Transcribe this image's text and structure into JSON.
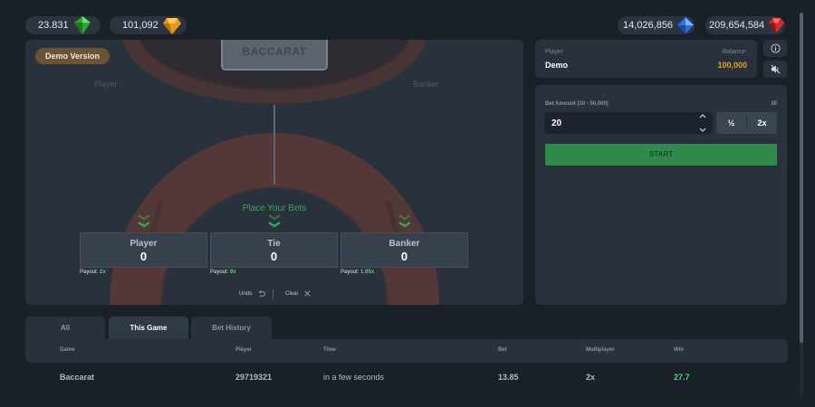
{
  "balances": {
    "green": "23.831",
    "orange": "101,092",
    "blue": "14,026,856",
    "red": "209,654,584"
  },
  "icons": {
    "green": "green-gem-icon",
    "orange": "orange-gem-icon",
    "blue": "blue-gem-icon",
    "red": "red-gem-icon",
    "info": "info-icon",
    "sound": "sound-off-icon",
    "undo": "undo-icon",
    "clear": "close-icon"
  },
  "table": {
    "demo_badge": "Demo Version",
    "shoe_label": "BACCARAT",
    "player_side": "Player",
    "banker_side": "Banker",
    "place_bets": "Place Your Bets",
    "boxes": [
      {
        "name": "Player",
        "amount": "0",
        "payout_label": "Payout:",
        "payout_value": "2x"
      },
      {
        "name": "Tie",
        "amount": "0",
        "payout_label": "Payout:",
        "payout_value": "9x"
      },
      {
        "name": "Banker",
        "amount": "0",
        "payout_label": "Payout:",
        "payout_value": "1.95x"
      }
    ],
    "undo": "Undo",
    "clear": "Clear"
  },
  "player_card": {
    "label": "Player",
    "name": "Demo",
    "balance_label": "Balance:",
    "balance": "100,000"
  },
  "bet": {
    "label": "Bet Amount (10 - 50,000)",
    "max_value": "20",
    "value": "20",
    "half": "½",
    "double": "2x",
    "start": "START"
  },
  "tabs": [
    {
      "label": "All"
    },
    {
      "label": "This Game"
    },
    {
      "label": "Bet History"
    }
  ],
  "history": {
    "columns": [
      "Game",
      "Player",
      "Time",
      "Bet",
      "Multiplayer",
      "Win"
    ],
    "rows": [
      {
        "game": "Baccarat",
        "player": "29719321",
        "time": "in a few seconds",
        "bet": "13.85",
        "multiplier": "2x",
        "win": "27.7"
      }
    ]
  },
  "colors": {
    "background": "#1a2028",
    "panel": "#28313c",
    "accent_green": "#2f8a4c",
    "balance_orange": "#e8a020",
    "felt_arc": "#5a3a36"
  }
}
